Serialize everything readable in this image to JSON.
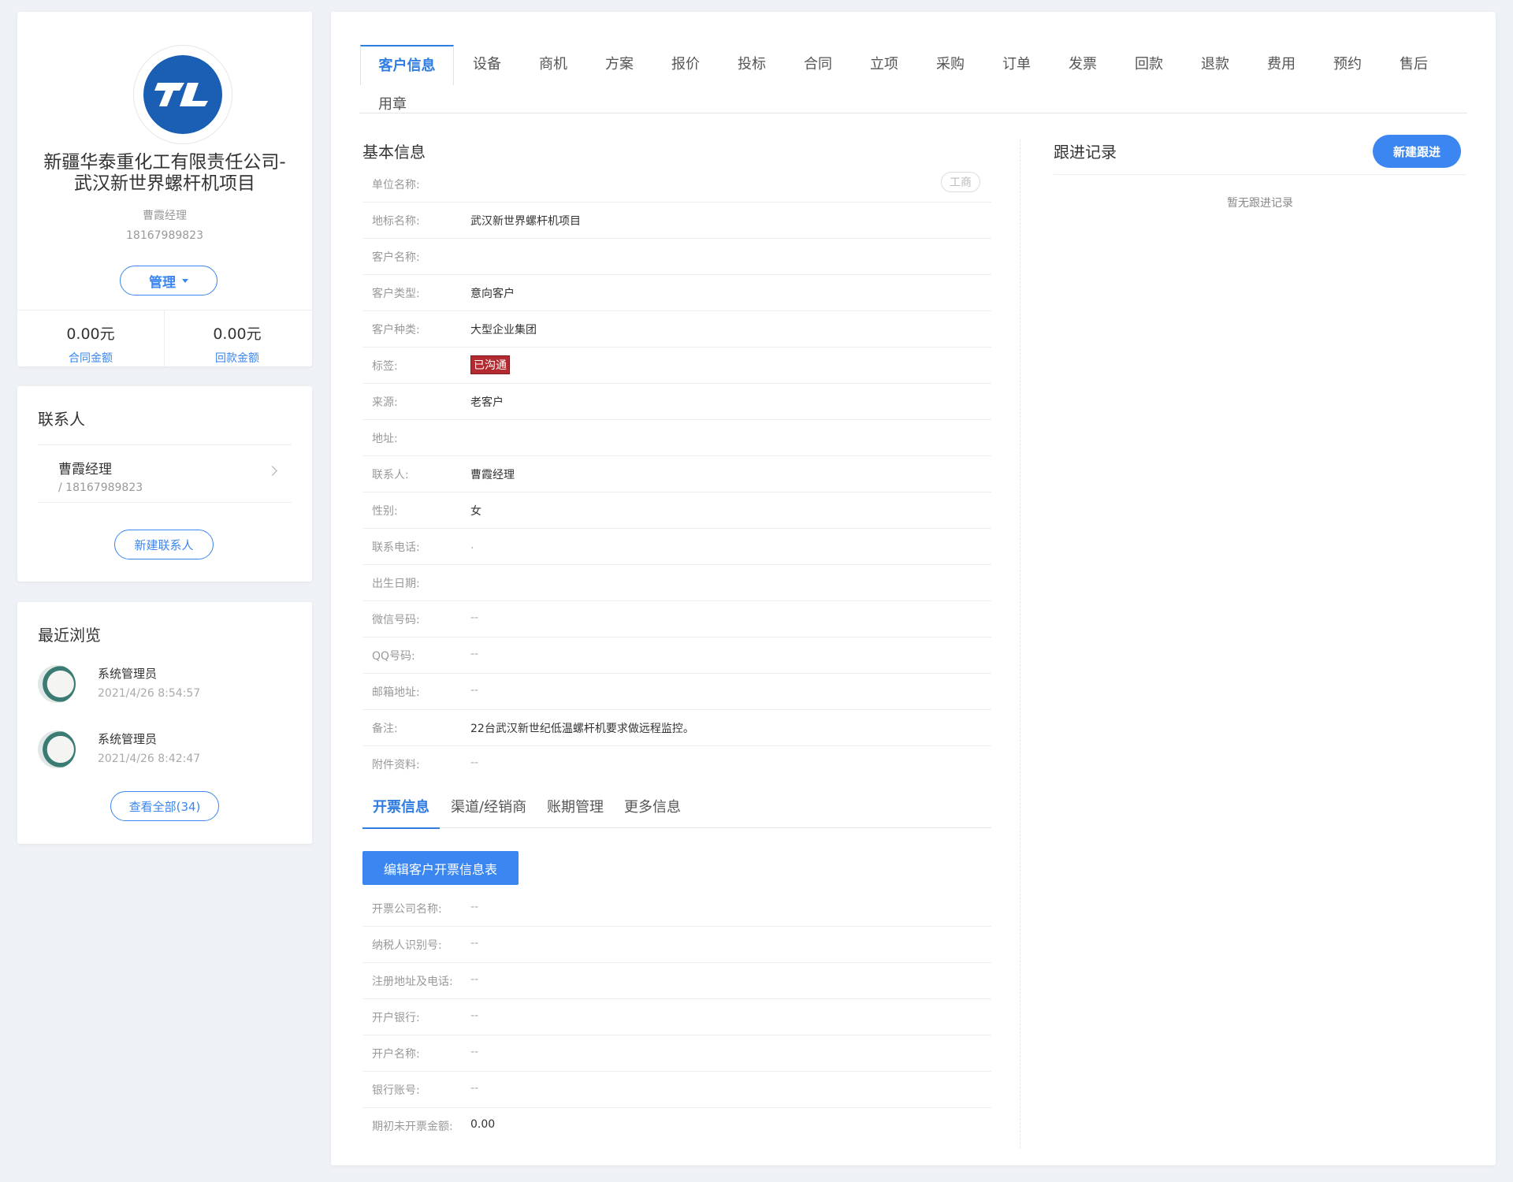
{
  "profile": {
    "company_line1": "新疆华泰重化工有限责任公司-",
    "company_line2": "武汉新世界螺杆机项目",
    "owner": "曹霞经理",
    "phone": "18167989823",
    "manage_label": "管理",
    "contract_amount": "0.00元",
    "contract_amount_label": "合同金额",
    "payment_amount": "0.00元",
    "payment_amount_label": "回款金额"
  },
  "contacts": {
    "title": "联系人",
    "items": [
      {
        "name": "曹霞经理",
        "phone": "/ 18167989823"
      }
    ],
    "new_label": "新建联系人"
  },
  "recent": {
    "title": "最近浏览",
    "items": [
      {
        "name": "系统管理员",
        "time": "2021/4/26 8:54:57"
      },
      {
        "name": "系统管理员",
        "time": "2021/4/26 8:42:47"
      }
    ],
    "view_all_label": "查看全部(34)"
  },
  "tabs": [
    "客户信息",
    "设备",
    "商机",
    "方案",
    "报价",
    "投标",
    "合同",
    "立项",
    "采购",
    "订单",
    "发票",
    "回款",
    "退款",
    "费用",
    "预约",
    "售后",
    "用章"
  ],
  "basic": {
    "title": "基本信息",
    "gongshang": "工商",
    "rows": [
      {
        "label": "单位名称:",
        "value": ""
      },
      {
        "label": "地标名称:",
        "value": "武汉新世界螺杆机项目"
      },
      {
        "label": "客户名称:",
        "value": ""
      },
      {
        "label": "客户类型:",
        "value": "意向客户"
      },
      {
        "label": "客户种类:",
        "value": "大型企业集团"
      },
      {
        "label": "标签:",
        "value": "已沟通"
      },
      {
        "label": "来源:",
        "value": "老客户"
      },
      {
        "label": "地址:",
        "value": ""
      },
      {
        "label": "联系人:",
        "value": "曹霞经理"
      },
      {
        "label": "性别:",
        "value": "女"
      },
      {
        "label": "联系电话:",
        "value": "."
      },
      {
        "label": "出生日期:",
        "value": ""
      },
      {
        "label": "微信号码:",
        "value": "--"
      },
      {
        "label": "QQ号码:",
        "value": "--"
      },
      {
        "label": "邮箱地址:",
        "value": "--"
      },
      {
        "label": "备注:",
        "value": "22台武汉新世纪低温螺杆机要求做远程监控。"
      },
      {
        "label": "附件资料:",
        "value": "--"
      }
    ]
  },
  "subtabs": [
    "开票信息",
    "渠道/经销商",
    "账期管理",
    "更多信息"
  ],
  "invoice": {
    "edit_label": "编辑客户开票信息表",
    "rows": [
      {
        "label": "开票公司名称:",
        "value": "--"
      },
      {
        "label": "纳税人识别号:",
        "value": "--"
      },
      {
        "label": "注册地址及电话:",
        "value": "--"
      },
      {
        "label": "开户银行:",
        "value": "--"
      },
      {
        "label": "开户名称:",
        "value": "--"
      },
      {
        "label": "银行账号:",
        "value": "--"
      },
      {
        "label": "期初未开票金额:",
        "value": "0.00"
      }
    ]
  },
  "follow": {
    "title": "跟进记录",
    "new_label": "新建跟进",
    "empty_text": "暂无跟进记录"
  }
}
